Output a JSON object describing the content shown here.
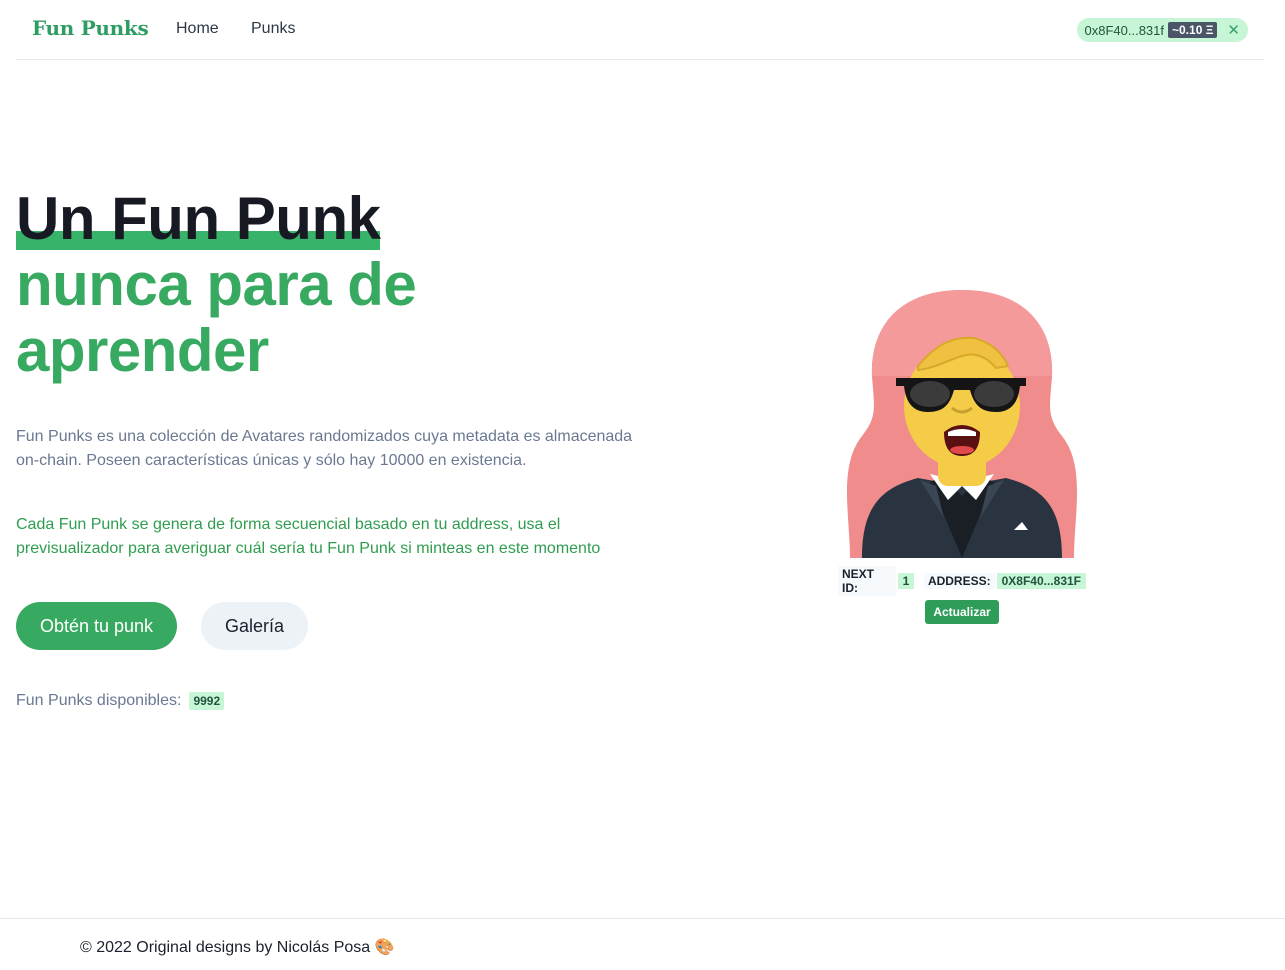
{
  "header": {
    "brand": "Fun Punks",
    "nav": {
      "home": "Home",
      "punks": "Punks"
    },
    "wallet": {
      "address": "0x8F40...831f",
      "balance": "~0.10 Ξ",
      "close_icon": "close-icon"
    }
  },
  "hero": {
    "title_line1": "Un Fun Punk",
    "title_line2": "nunca para de aprender",
    "description": "Fun Punks es una colección de Avatares randomizados cuya metadata es almacenada on-chain. Poseen características únicas y sólo hay 10000 en existencia.",
    "description_green": "Cada Fun Punk se genera de forma secuencial basado en tu address, usa el previsualizador para averiguar cuál sería tu Fun Punk si minteas en este momento",
    "primary_button": "Obtén tu punk",
    "secondary_button": "Galería",
    "available_label": "Fun Punks disponibles:",
    "available_count": "9992"
  },
  "preview": {
    "next_id_label": "NEXT ID:",
    "next_id": "1",
    "address_label": "ADDRESS:",
    "address": "0X8F40...831F",
    "update_button": "Actualizar"
  },
  "footer": {
    "text": "© 2022 Original designs by Nicolás Posa 🎨"
  },
  "colors": {
    "brand_green": "#38a961",
    "badge_green_bg": "#c6f6d5",
    "dark_text": "#171923"
  }
}
